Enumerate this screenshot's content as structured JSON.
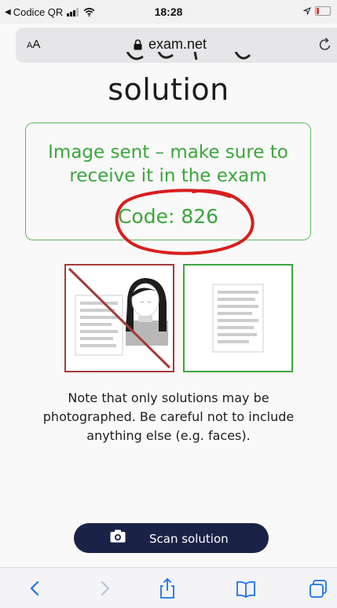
{
  "status_bar": {
    "back_app": "Codice QR",
    "time": "18:28"
  },
  "address_bar": {
    "aa_label_small": "A",
    "aa_label_large": "A",
    "domain": "exam.net"
  },
  "page": {
    "heading": "solution",
    "success_message": "Image sent – make sure to receive it in the exam",
    "code_line": "Code: 826",
    "note": "Note that only solutions may be photographed. Be careful not to include anything else (e.g. faces).",
    "scan_button_label": "Scan solution"
  },
  "colors": {
    "success_green": "#3aa63a",
    "bad_red": "#a33a3a",
    "button_navy": "#1a2347",
    "annotation_red": "#d81e1e",
    "ios_blue": "#1a73e8"
  },
  "icons": {
    "status": [
      "back-arrow-icon",
      "signal-icon",
      "wifi-icon",
      "location-icon",
      "battery-icon"
    ],
    "address": [
      "lock-icon",
      "reload-icon"
    ],
    "button": "camera-icon",
    "toolbar": [
      "back-icon",
      "forward-icon",
      "share-icon",
      "bookmarks-icon",
      "tabs-icon"
    ]
  }
}
